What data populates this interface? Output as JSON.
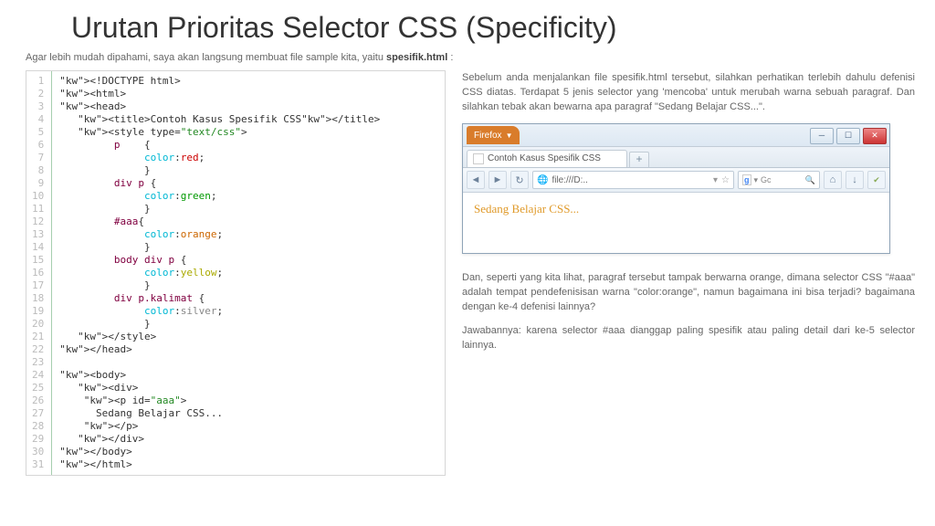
{
  "title": "Urutan Prioritas Selector CSS (Specificity)",
  "intro_a": "Agar lebih mudah dipahami, saya akan langsung membuat file sample kita, yaitu ",
  "intro_b": "spesifik.html",
  "intro_c": " :",
  "code": {
    "lines": [
      "<!DOCTYPE html>",
      "<html>",
      "<head>",
      "   <title>Contoh Kasus Spesifik CSS</title>",
      "   <style type=\"text/css\">",
      "         p    {",
      "              color:red;",
      "              }",
      "         div p {",
      "              color:green;",
      "              }",
      "         #aaa{",
      "              color:orange;",
      "              }",
      "         body div p {",
      "              color:yellow;",
      "              }",
      "         div p.kalimat {",
      "              color:silver;",
      "              }",
      "   </style>",
      "</head>",
      "",
      "<body>",
      "   <div>",
      "    <p id=\"aaa\">",
      "      Sedang Belajar CSS...",
      "    </p>",
      "   </div>",
      "</body>",
      "</html>"
    ]
  },
  "r1": "Sebelum anda menjalankan file spesifik.html tersebut, silahkan perhatikan terlebih dahulu defenisi CSS diatas. Terdapat 5 jenis selector yang 'mencoba' untuk merubah warna sebuah paragraf. Dan silahkan tebak akan bewarna apa paragraf \"Sedang Belajar CSS...\".",
  "browser": {
    "ff": "Firefox",
    "tab": "Contoh Kasus Spesifik CSS",
    "url": "file:///D:..",
    "search": "Gc",
    "content": "Sedang Belajar CSS..."
  },
  "r2": "Dan, seperti yang kita lihat, paragraf tersebut tampak berwarna orange, dimana selector CSS \"#aaa\" adalah tempat pendefenisisan warna \"color:orange\", namun bagaimana ini bisa terjadi? bagaimana dengan ke-4 defenisi lainnya?",
  "r3": "Jawabannya: karena selector #aaa dianggap paling spesifik atau paling detail dari ke-5 selector lainnya."
}
